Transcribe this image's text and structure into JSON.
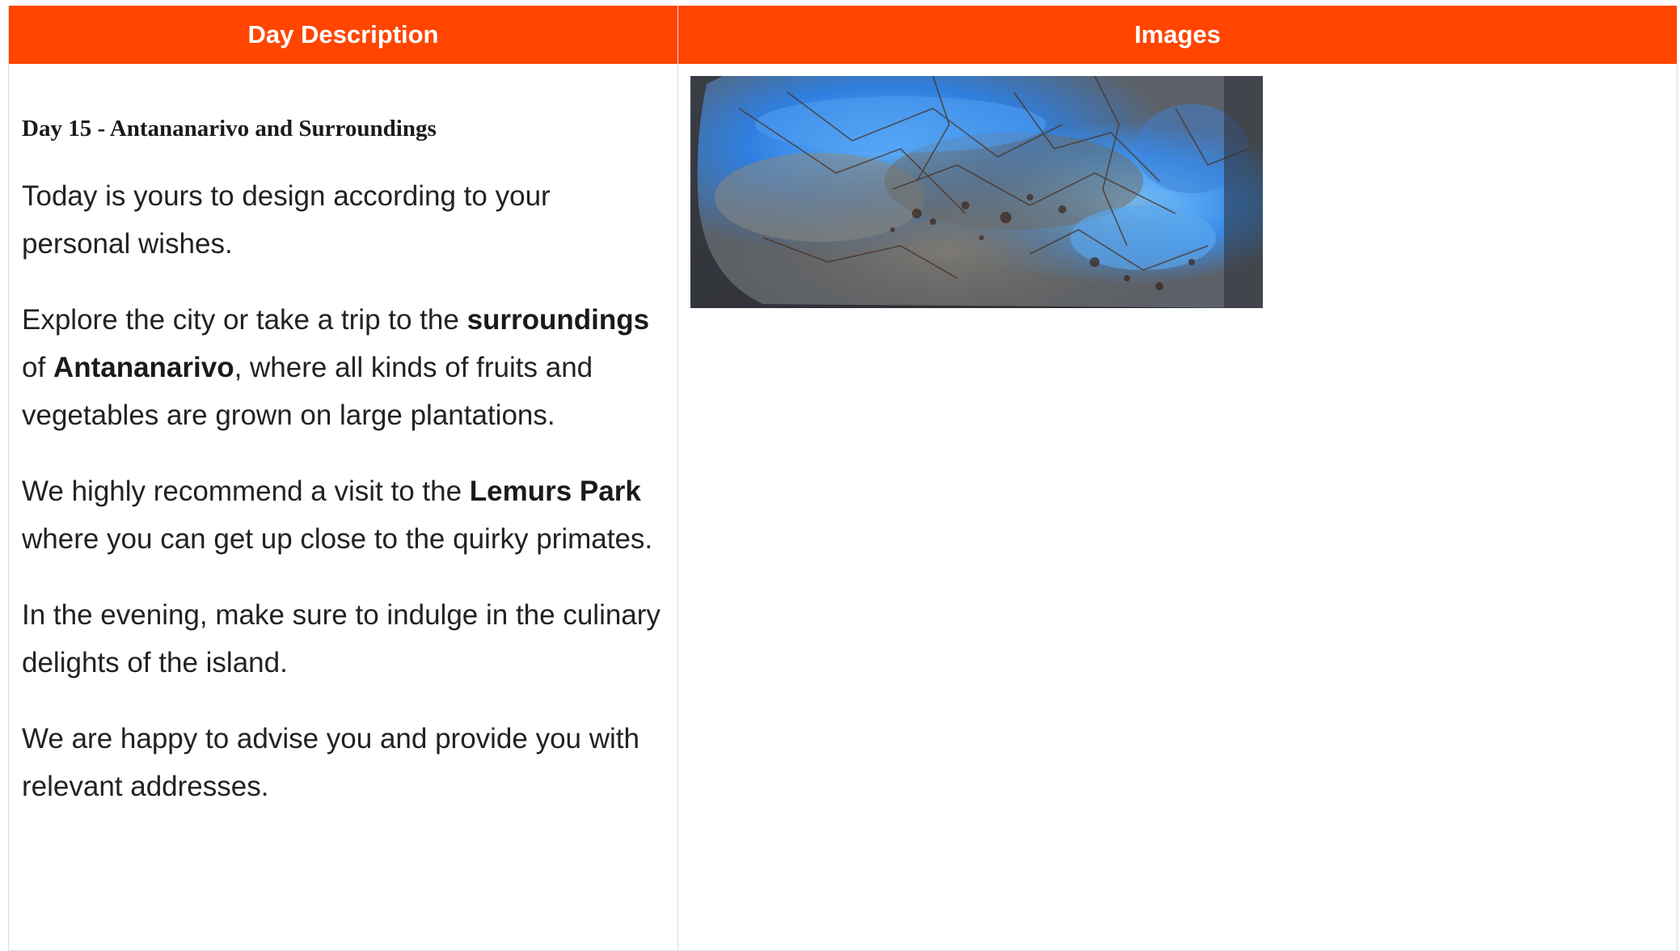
{
  "table": {
    "headers": {
      "description": "Day Description",
      "images": "Images"
    }
  },
  "day": {
    "heading": "Day 15 - Antananarivo and Surroundings",
    "paragraph_1": "Today is yours to design according to your personal wishes.",
    "paragraph_2": {
      "part_1": "Explore the city or take a trip to the ",
      "bold_1": "surroundings",
      "part_2": " of ",
      "bold_2": "Antananarivo",
      "part_3": ", where all kinds of fruits and vegetables are grown on large plantations."
    },
    "paragraph_3": {
      "part_1": "We highly recommend a visit to the ",
      "bold_1": "Lemurs Park",
      "part_2": " where you can get up close to the quirky primates."
    },
    "paragraph_4": "In the evening, make sure to indulge in the culinary delights of the island.",
    "paragraph_5": "We are happy to advise you and provide you with relevant addresses."
  },
  "images": {
    "photo_subject": "labradorite-gemstone",
    "colors": {
      "header_bg": "#ff4500",
      "header_text": "#ffffff",
      "photo_blue": "#3b8fe6",
      "photo_gray": "#6f7275"
    }
  }
}
